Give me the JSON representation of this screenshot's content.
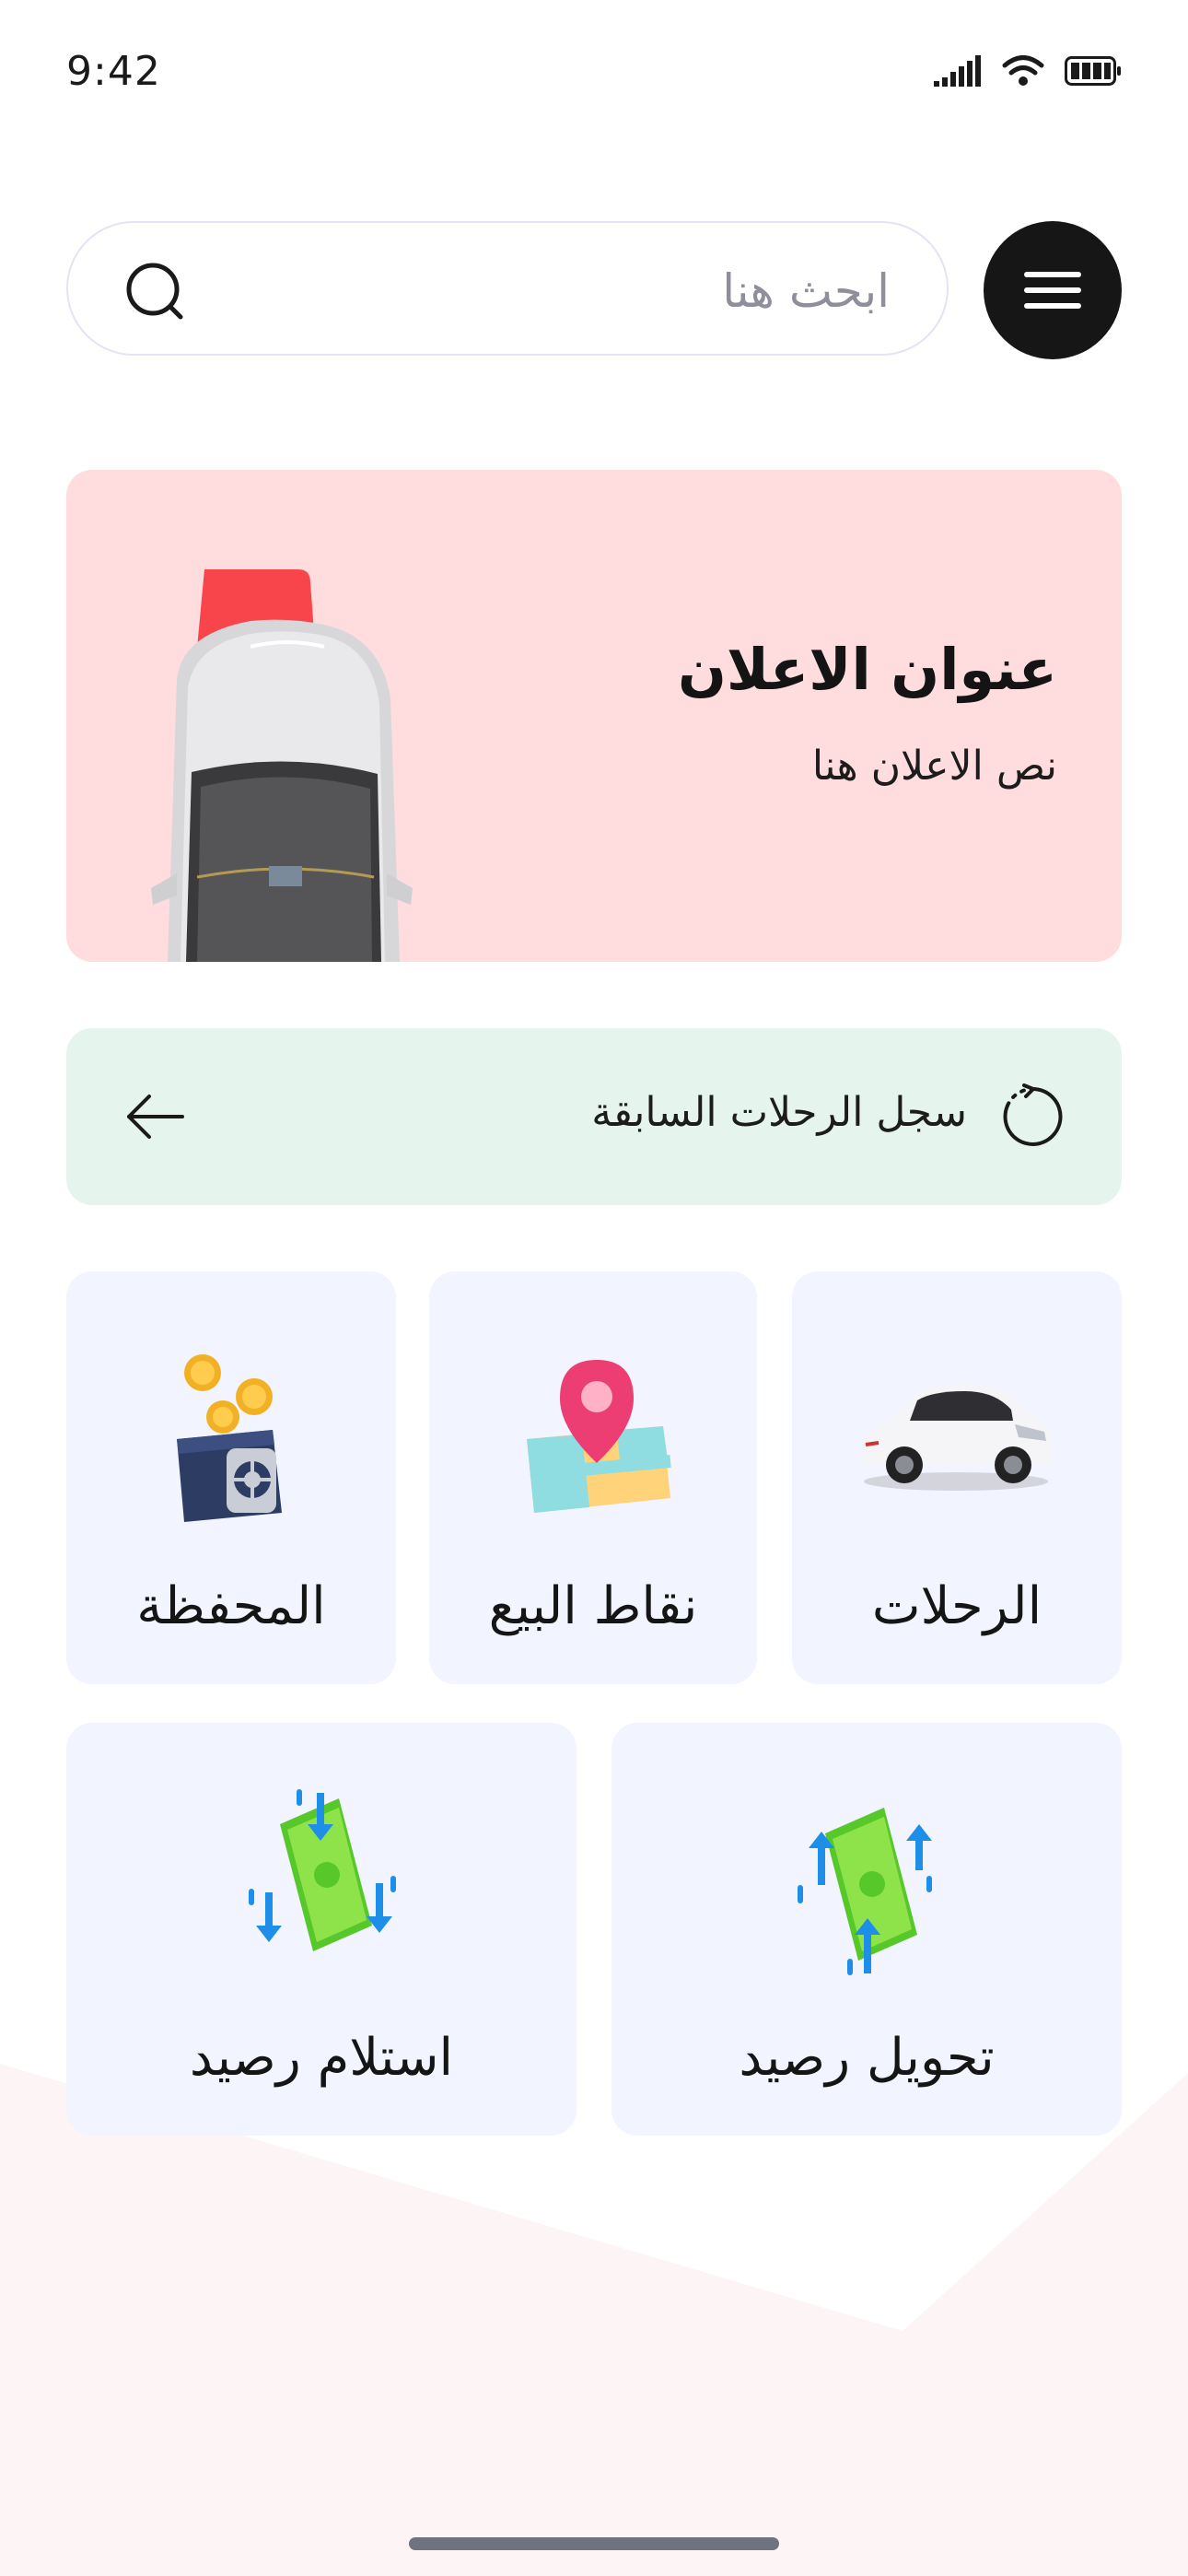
{
  "status_bar": {
    "time": "9:42",
    "icons": [
      "signal-icon",
      "wifi-icon",
      "battery-icon"
    ]
  },
  "header": {
    "search_placeholder": "ابحث هنا",
    "search_value": "",
    "search_icon": "search-icon",
    "menu_icon": "hamburger-menu-icon"
  },
  "ad": {
    "title": "عنوان الاعلان",
    "text": "نص الاعلان هنا",
    "image": "car-top-view-image",
    "background_color": "#ffdcdd"
  },
  "history": {
    "label": "سجل الرحلات السابقة",
    "icon": "history-icon",
    "arrow_icon": "arrow-left-icon",
    "background_color": "#e5f5ee"
  },
  "services": [
    {
      "label": "الرحلات",
      "icon": "car-icon"
    },
    {
      "label": "نقاط البيع",
      "icon": "map-pin-icon"
    },
    {
      "label": "المحفظة",
      "icon": "wallet-safe-icon"
    },
    {
      "label": "تحويل رصيد",
      "icon": "money-transfer-icon"
    },
    {
      "label": "استلام رصيد",
      "icon": "money-receive-icon"
    }
  ],
  "colors": {
    "tile_background": "#f2f4ff",
    "menu_button": "#161616",
    "search_border": "#e2e4f6"
  }
}
